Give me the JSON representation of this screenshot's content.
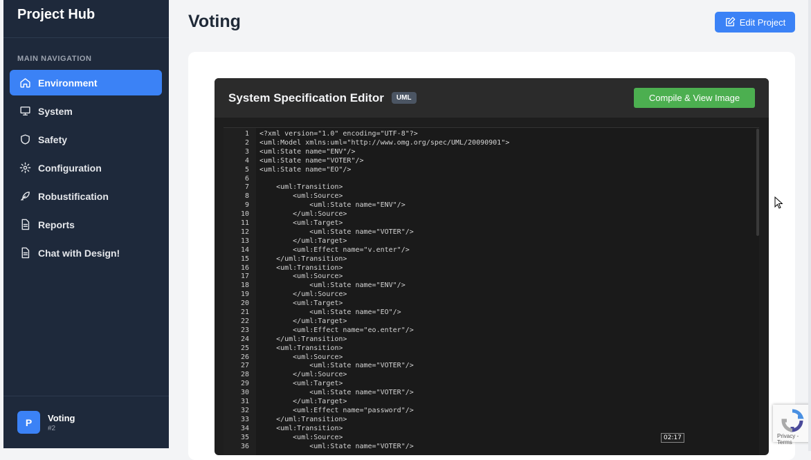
{
  "sidebar": {
    "brand": "Project Hub",
    "nav_heading": "MAIN NAVIGATION",
    "items": [
      {
        "label": "Environment",
        "icon": "home-icon",
        "active": true
      },
      {
        "label": "System",
        "icon": "monitor-icon"
      },
      {
        "label": "Safety",
        "icon": "shield-icon"
      },
      {
        "label": "Configuration",
        "icon": "gear-icon"
      },
      {
        "label": "Robustification",
        "icon": "feather-icon"
      },
      {
        "label": "Reports",
        "icon": "document-icon"
      },
      {
        "label": "Chat with Design!",
        "icon": "document-icon"
      }
    ],
    "project": {
      "avatar_letter": "P",
      "name": "Voting",
      "id": "#2"
    }
  },
  "header": {
    "title": "Voting",
    "edit_button": "Edit Project"
  },
  "editor": {
    "title": "System Specification Editor",
    "badge": "UML",
    "compile_button": "Compile & View Image",
    "lines": [
      "<?xml version=\"1.0\" encoding=\"UTF-8\"?>",
      "<uml:Model xmlns:uml=\"http://www.omg.org/spec/UML/20090901\">",
      "<uml:State name=\"ENV\"/>",
      "<uml:State name=\"VOTER\"/>",
      "<uml:State name=\"EO\"/>",
      "",
      "    <uml:Transition>",
      "        <uml:Source>",
      "            <uml:State name=\"ENV\"/>",
      "        </uml:Source>",
      "        <uml:Target>",
      "            <uml:State name=\"VOTER\"/>",
      "        </uml:Target>",
      "        <uml:Effect name=\"v.enter\"/>",
      "    </uml:Transition>",
      "    <uml:Transition>",
      "        <uml:Source>",
      "            <uml:State name=\"ENV\"/>",
      "        </uml:Source>",
      "        <uml:Target>",
      "            <uml:State name=\"EO\"/>",
      "        </uml:Target>",
      "        <uml:Effect name=\"eo.enter\"/>",
      "    </uml:Transition>",
      "    <uml:Transition>",
      "        <uml:Source>",
      "            <uml:State name=\"VOTER\"/>",
      "        </uml:Source>",
      "        <uml:Target>",
      "            <uml:State name=\"VOTER\"/>",
      "        </uml:Target>",
      "        <uml:Effect name=\"password\"/>",
      "    </uml:Transition>",
      "    <uml:Transition>",
      "        <uml:Source>",
      "            <uml:State name=\"VOTER\"/>"
    ]
  },
  "video_time": "02:17",
  "recaptcha_text": "Privacy - Terms",
  "colors": {
    "sidebar_bg": "#1e293b",
    "accent": "#3b82f6",
    "compile_green": "#4caf50",
    "editor_bg": "#1e1e1e"
  }
}
